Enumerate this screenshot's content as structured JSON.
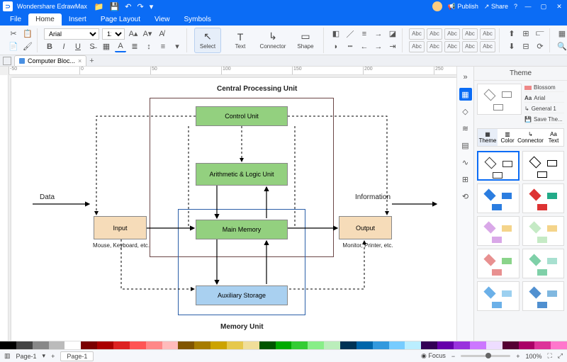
{
  "title": "Wondershare EdrawMax",
  "menu": [
    "File",
    "Home",
    "Insert",
    "Page Layout",
    "View",
    "Symbols"
  ],
  "activeMenu": "Home",
  "topRight": {
    "publish": "Publish",
    "share": "Share"
  },
  "font": {
    "name": "Arial",
    "size": "12"
  },
  "bigTools": [
    "Select",
    "Text",
    "Connector",
    "Shape"
  ],
  "abc": "Abc",
  "docTab": {
    "name": "Computer Bloc..."
  },
  "diagram": {
    "title": "Central Processing Unit",
    "control": "Control Unit",
    "alu": "Arithmetic & Logic Unit",
    "mainmem": "Main Memory",
    "aux": "Auxiliary Storage",
    "memunit": "Memory Unit",
    "input": "Input",
    "output": "Output",
    "data": "Data",
    "info": "Information",
    "inCap": "Mouse, Keyboard, etc.",
    "outCap": "Monitor, Printer, etc."
  },
  "panel": {
    "title": "Theme",
    "rows": [
      "Blossom",
      "Arial",
      "General 1",
      "Save The..."
    ],
    "subtabs": [
      "Theme",
      "Color",
      "Connector",
      "Text"
    ]
  },
  "ruler": [
    "-50",
    "0",
    "50",
    "100",
    "150",
    "200",
    "250"
  ],
  "palette": [
    "#000",
    "#444",
    "#888",
    "#bbb",
    "#fff",
    "#7a0000",
    "#a00",
    "#d22",
    "#f55",
    "#f88",
    "#fbb",
    "#805500",
    "#a67c00",
    "#cca300",
    "#e6c84d",
    "#f0de99",
    "#005500",
    "#0a0",
    "#3c3",
    "#8e8",
    "#beb",
    "#003355",
    "#06a",
    "#39d",
    "#7cf",
    "#bef",
    "#330055",
    "#60a",
    "#93d",
    "#c7f",
    "#edf",
    "#550033",
    "#a06",
    "#d39",
    "#f7c"
  ],
  "status": {
    "page": "Page-1",
    "pageTab": "Page-1",
    "focus": "Focus",
    "zoom": "100%"
  },
  "galleryColors": [
    [
      "#333",
      "#333"
    ],
    [
      "#000",
      "#000"
    ],
    [
      "#2b7de0",
      "#2b7de0"
    ],
    [
      "#d33",
      "#2a8"
    ],
    [
      "#d9a8e8",
      "#f4d48a"
    ],
    [
      "#c5eac5",
      "#f4d48a"
    ],
    [
      "#e89090",
      "#8ad48a"
    ],
    [
      "#7fd0a8",
      "#a8e0d0"
    ],
    [
      "#6bb0e8",
      "#9cd0f0"
    ],
    [
      "#5090d0",
      "#80b8e0"
    ]
  ]
}
